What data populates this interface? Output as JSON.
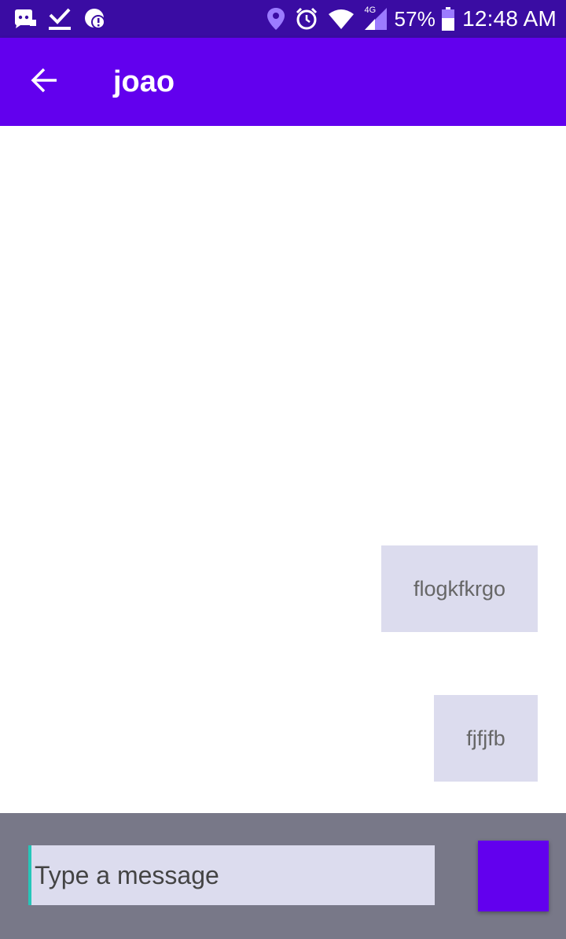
{
  "status_bar": {
    "left_icons": [
      "discord-icon",
      "download-done-icon",
      "alert-cloud-icon"
    ],
    "right_icons": [
      "location-icon",
      "alarm-icon",
      "wifi-icon",
      "signal-icon",
      "battery-icon"
    ],
    "network_type": "4G",
    "battery": "57%",
    "time": "12:48 AM",
    "background_color": "#3a0ca3"
  },
  "app_bar": {
    "back_icon": "arrow-back-icon",
    "title": "joao",
    "background_color": "#6200ee"
  },
  "messages": [
    {
      "text": "flogkfkrgo",
      "direction": "outgoing"
    },
    {
      "text": "fjfjfb",
      "direction": "outgoing"
    }
  ],
  "composer": {
    "placeholder": "Type a message",
    "value": "",
    "send_button_color": "#6200ee",
    "background_color": "#787888"
  }
}
